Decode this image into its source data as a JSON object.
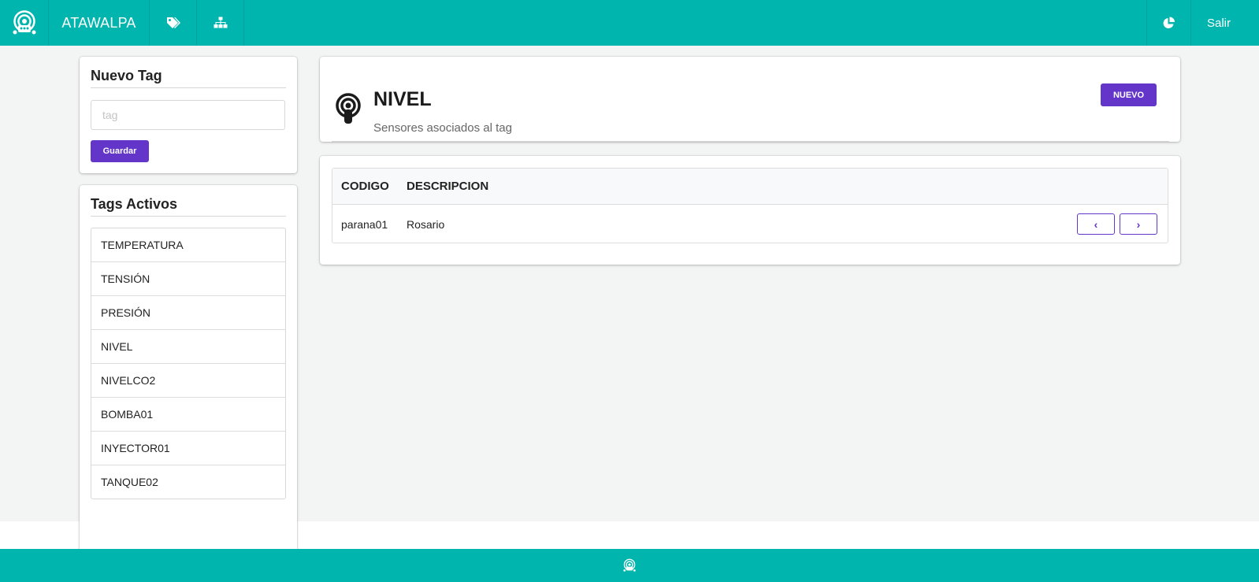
{
  "colors": {
    "teal": "#00b5ad",
    "purple": "#6435c9",
    "background": "#f3f4f4"
  },
  "navbar": {
    "logo_icon": "atawalpa-logo-icon",
    "brand": "ATAWALPA",
    "tags_icon": "tags-icon",
    "sitemap_icon": "sitemap-icon",
    "chart_icon": "pie-chart-icon",
    "logout_label": "Salir"
  },
  "new_tag": {
    "title": "Nuevo Tag",
    "input_placeholder": "tag",
    "input_value": "",
    "save_label": "Guardar"
  },
  "active_tags": {
    "title": "Tags Activos",
    "items": [
      "TEMPERATURA",
      "TENSIÓN",
      "PRESIÓN",
      "NIVEL",
      "NIVELCO2",
      "BOMBA01",
      "INYECTOR01",
      "TANQUE02"
    ]
  },
  "tag_header": {
    "icon": "podcast-icon",
    "title": "NIVEL",
    "subtitle": "Sensores asociados al tag",
    "new_label": "NUEVO"
  },
  "sensors_table": {
    "columns": [
      "CODIGO",
      "DESCRIPCION"
    ],
    "rows": [
      {
        "codigo": "parana01",
        "descripcion": "Rosario"
      }
    ],
    "prev_label": "‹",
    "next_label": "›"
  },
  "footer": {
    "icon": "atawalpa-logo-icon"
  }
}
